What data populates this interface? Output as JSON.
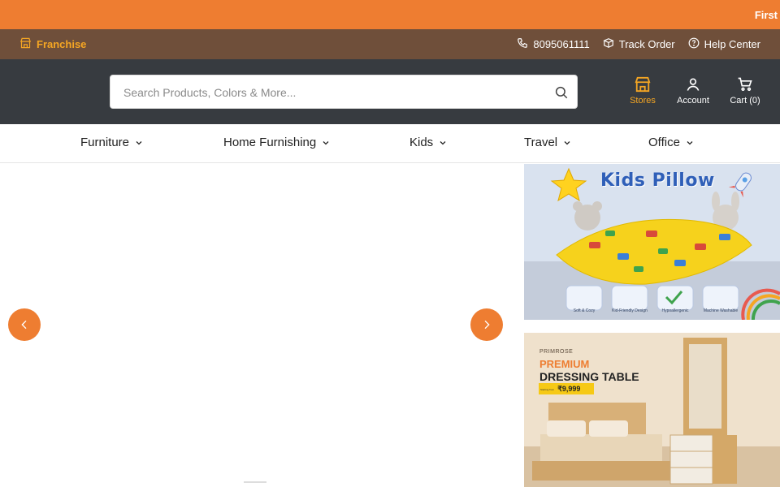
{
  "announcement": {
    "text": "First"
  },
  "utility_bar": {
    "franchise_label": "Franchise",
    "phone": "8095061111",
    "track_order": "Track Order",
    "help_center": "Help Center"
  },
  "header": {
    "search": {
      "placeholder": "Search Products, Colors & More..."
    },
    "actions": {
      "stores": "Stores",
      "account": "Account",
      "cart": "Cart (0)"
    }
  },
  "nav": {
    "items": [
      {
        "label": "Furniture"
      },
      {
        "label": "Home Furnishing"
      },
      {
        "label": "Kids"
      },
      {
        "label": "Travel"
      },
      {
        "label": "Office"
      }
    ]
  },
  "promos": {
    "kids_pillow": {
      "title": "Kids Pillow",
      "features": [
        "Soft & Cozy",
        "Kid-Friendly Design",
        "Hypoallergenic",
        "Machine Washable"
      ]
    },
    "dressing_table": {
      "brand": "PRIMROSE",
      "headline1": "PREMIUM",
      "headline2": "DRESSING TABLE",
      "price_prefix": "Starting from",
      "price": "₹9,999"
    }
  },
  "colors": {
    "accent_orange": "#ee7d31",
    "utility_brown": "#6f4f3a",
    "header_dark": "#373b40",
    "stores_gold": "#f5a623"
  }
}
